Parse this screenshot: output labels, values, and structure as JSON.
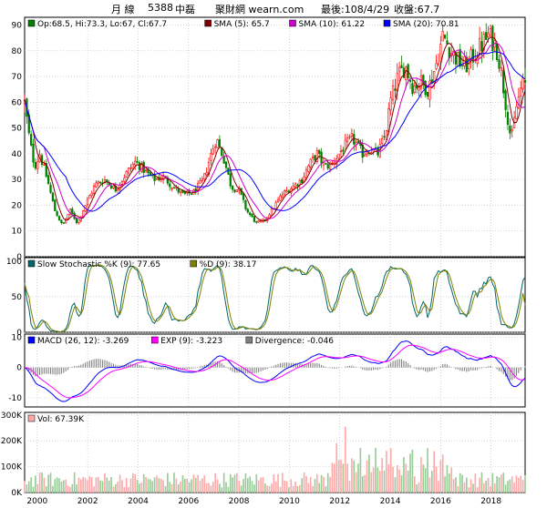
{
  "header": {
    "period": "月 線",
    "code": "5388",
    "name": "中磊",
    "site": "聚財網 wearn.com",
    "last_date": "最後:108/4/29",
    "close_label": "收盤:67.7"
  },
  "colors": {
    "up": "#ff0000",
    "down": "#008000",
    "sma5": "#800000",
    "sma10": "#cc00cc",
    "sma20": "#0000ff",
    "k": "#006666",
    "d": "#808000",
    "macd": "#0000ff",
    "exp": "#ff00ff",
    "divergence": "#808080",
    "vol": "#ffaaaa"
  },
  "chart_data": [
    {
      "type": "candlestick",
      "panel": "price",
      "legend": [
        {
          "key": "ohlc",
          "text": "Op:68.5, Hi:73.3, Lo:67, Cl:67.7",
          "color": "#008000"
        },
        {
          "key": "sma5",
          "text": "SMA (5): 65.7",
          "color": "#800000"
        },
        {
          "key": "sma10",
          "text": "SMA (10): 61.22",
          "color": "#cc00cc"
        },
        {
          "key": "sma20",
          "text": "SMA (20): 70.81",
          "color": "#0000ff"
        }
      ],
      "ylim": [
        0,
        93
      ],
      "yticks": [
        0,
        10,
        20,
        30,
        40,
        50,
        60,
        70,
        80,
        90
      ],
      "x_range": [
        1999.5,
        2019.35
      ],
      "xticks": [
        "2000",
        "2002",
        "2004",
        "2006",
        "2008",
        "2010",
        "2012",
        "2014",
        "2016",
        "2018"
      ],
      "anchors": [
        [
          1999.5,
          60
        ],
        [
          1999.7,
          45
        ],
        [
          1999.9,
          35
        ],
        [
          2000.1,
          40
        ],
        [
          2000.4,
          30
        ],
        [
          2000.7,
          18
        ],
        [
          2001.0,
          12
        ],
        [
          2001.3,
          18
        ],
        [
          2001.6,
          13
        ],
        [
          2001.9,
          20
        ],
        [
          2002.3,
          28
        ],
        [
          2002.7,
          30
        ],
        [
          2003.1,
          26
        ],
        [
          2003.5,
          32
        ],
        [
          2003.9,
          37
        ],
        [
          2004.2,
          34
        ],
        [
          2004.6,
          30
        ],
        [
          2005.0,
          31
        ],
        [
          2005.4,
          27
        ],
        [
          2005.8,
          24
        ],
        [
          2006.2,
          25
        ],
        [
          2006.6,
          30
        ],
        [
          2006.9,
          40
        ],
        [
          2007.1,
          46
        ],
        [
          2007.4,
          38
        ],
        [
          2007.7,
          27
        ],
        [
          2008.0,
          26
        ],
        [
          2008.3,
          18
        ],
        [
          2008.7,
          13
        ],
        [
          2009.0,
          14
        ],
        [
          2009.3,
          18
        ],
        [
          2009.7,
          24
        ],
        [
          2010.1,
          27
        ],
        [
          2010.5,
          30
        ],
        [
          2010.8,
          36
        ],
        [
          2011.1,
          40
        ],
        [
          2011.4,
          35
        ],
        [
          2011.7,
          36
        ],
        [
          2012.1,
          42
        ],
        [
          2012.5,
          46
        ],
        [
          2012.9,
          40
        ],
        [
          2013.2,
          42
        ],
        [
          2013.5,
          40
        ],
        [
          2013.8,
          47
        ],
        [
          2014.0,
          60
        ],
        [
          2014.3,
          70
        ],
        [
          2014.6,
          74
        ],
        [
          2014.9,
          66
        ],
        [
          2015.2,
          68
        ],
        [
          2015.5,
          65
        ],
        [
          2015.8,
          74
        ],
        [
          2016.1,
          86
        ],
        [
          2016.4,
          80
        ],
        [
          2016.7,
          76
        ],
        [
          2017.0,
          74
        ],
        [
          2017.3,
          78
        ],
        [
          2017.6,
          82
        ],
        [
          2017.9,
          86
        ],
        [
          2018.2,
          82
        ],
        [
          2018.4,
          72
        ],
        [
          2018.6,
          58
        ],
        [
          2018.8,
          45
        ],
        [
          2019.0,
          58
        ],
        [
          2019.2,
          66
        ],
        [
          2019.35,
          67.7
        ]
      ],
      "last_bar": {
        "open": 68.5,
        "high": 73.3,
        "low": 67,
        "close": 67.7
      }
    },
    {
      "type": "line",
      "panel": "stochastic",
      "legend": [
        {
          "key": "k",
          "text": "Slow Stochastic %K (9): 77.65",
          "color": "#006666"
        },
        {
          "key": "d",
          "text": "%D (9): 38.17",
          "color": "#808000"
        }
      ],
      "ylim": [
        0,
        105
      ],
      "yticks": [
        0,
        50,
        100
      ]
    },
    {
      "type": "line",
      "panel": "macd",
      "legend": [
        {
          "key": "macd",
          "text": "MACD (26, 12): -3.269",
          "color": "#0000ff"
        },
        {
          "key": "exp",
          "text": "EXP (9): -3.223",
          "color": "#ff00ff"
        },
        {
          "key": "div",
          "text": "Divergence: -0.046",
          "color": "#808080"
        }
      ],
      "ylim": [
        -13,
        11
      ],
      "yticks": [
        -10,
        0,
        10
      ]
    },
    {
      "type": "bar",
      "panel": "volume",
      "legend": [
        {
          "key": "vol",
          "text": "Vol: 67.39K",
          "color": "#ffaaaa"
        }
      ],
      "ylim": [
        0,
        310000
      ],
      "yticks": [
        0,
        100000,
        200000,
        300000
      ],
      "ytick_labels": [
        "0K",
        "100K",
        "200K",
        "300K"
      ]
    }
  ]
}
